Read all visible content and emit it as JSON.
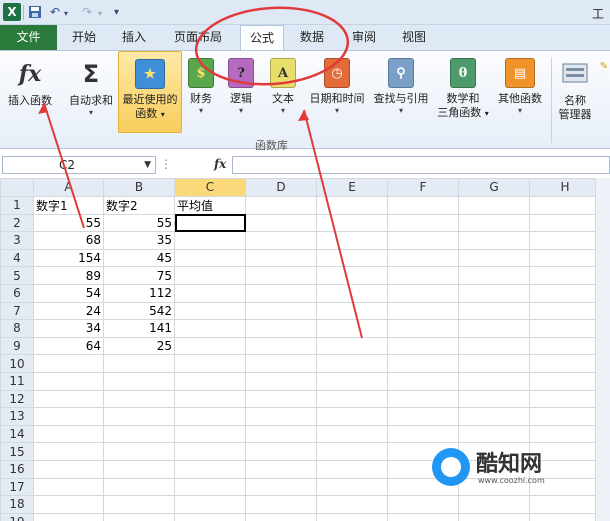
{
  "titlebar": {
    "app_icon": "X",
    "undo_icon": "↶",
    "redo_icon": "↷",
    "save_icon": "▪",
    "title_fragment": "工"
  },
  "tabs": [
    "文件",
    "开始",
    "插入",
    "页面布局",
    "公式",
    "数据",
    "审阅",
    "视图"
  ],
  "ribbon": {
    "insert_function": "插入函数",
    "autosum": "自动求和",
    "recent_line1": "最近使用的",
    "recent_line2": "函数",
    "financial": "财务",
    "logical": "逻辑",
    "text": "文本",
    "datetime": "日期和时间",
    "lookup": "查找与引用",
    "math_line1": "数学和",
    "math_line2": "三角函数",
    "more": "其他函数",
    "name_line1": "名称",
    "name_line2": "管理器",
    "group_label": "函数库",
    "dropdown_glyph": "▾",
    "book_logical": "?",
    "book_text": "A",
    "book_math": "θ",
    "fx_glyph": "fx",
    "sigma_glyph": "Σ"
  },
  "formula_bar": {
    "name_box": "C2",
    "fx_glyph": "fx",
    "formula": ""
  },
  "grid": {
    "columns": [
      "A",
      "B",
      "C",
      "D",
      "E",
      "F",
      "G",
      "H"
    ],
    "rows": [
      [
        "数字1",
        "数字2",
        "平均值"
      ],
      [
        "55",
        "55",
        ""
      ],
      [
        "68",
        "35",
        ""
      ],
      [
        "154",
        "45",
        ""
      ],
      [
        "89",
        "75",
        ""
      ],
      [
        "54",
        "112",
        ""
      ],
      [
        "24",
        "542",
        ""
      ],
      [
        "34",
        "141",
        ""
      ],
      [
        "64",
        "25",
        ""
      ],
      [
        "",
        "",
        ""
      ],
      [
        "",
        "",
        ""
      ],
      [
        "",
        "",
        ""
      ],
      [
        "",
        "",
        ""
      ],
      [
        "",
        "",
        ""
      ],
      [
        "",
        "",
        ""
      ],
      [
        "",
        "",
        ""
      ],
      [
        "",
        "",
        ""
      ],
      [
        "",
        "",
        ""
      ],
      [
        "",
        "",
        ""
      ]
    ],
    "active_cell": "C2"
  },
  "watermark": {
    "brand": "酷知网",
    "url": "www.coozhi.com"
  },
  "colors": {
    "file_tab": "#2a7a3b",
    "annotation": "#e03a3a",
    "selected_header": "#f9d97a",
    "highlight_button": "#f8cd5d"
  }
}
